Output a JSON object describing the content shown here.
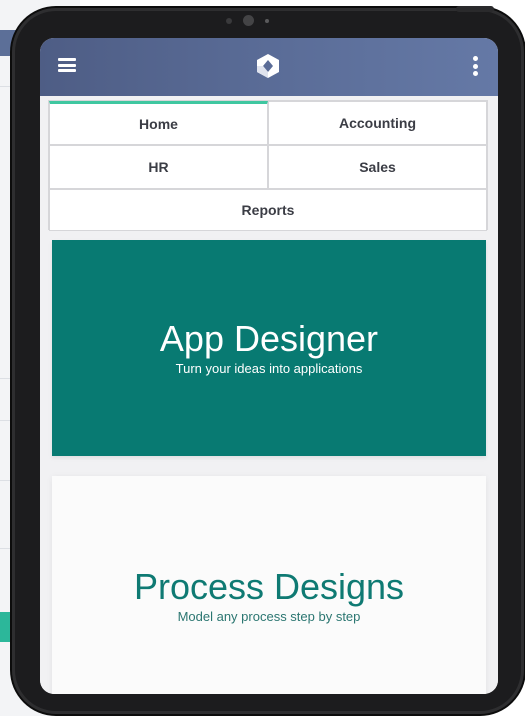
{
  "topbar": {
    "menu_icon": "hamburger-menu-icon",
    "logo_icon": "hexagon-logo-icon",
    "more_icon": "vertical-dots-icon",
    "color_start": "#4e5d85",
    "color_end": "#6579a6"
  },
  "tabs": [
    {
      "label": "Home",
      "active": true
    },
    {
      "label": "Accounting",
      "active": false
    },
    {
      "label": "HR",
      "active": false
    },
    {
      "label": "Sales",
      "active": false
    },
    {
      "label": "Reports",
      "active": false
    }
  ],
  "cards": {
    "app_designer": {
      "title": "App Designer",
      "subtitle": "Turn your ideas into applications",
      "color": "#087a72"
    },
    "process_designs": {
      "title": "Process Designs",
      "subtitle": "Model any process step by step",
      "color": "#0f7a73"
    }
  },
  "accent_color": "#3fc7a0"
}
